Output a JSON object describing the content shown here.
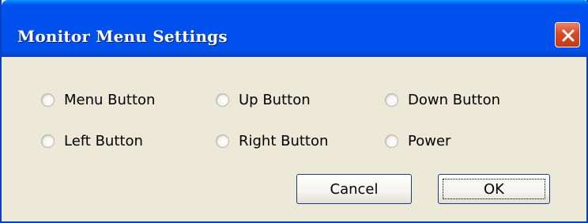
{
  "window": {
    "title": "Monitor Menu Settings",
    "close_icon": "close-icon"
  },
  "options": [
    {
      "label": "Menu Button",
      "checked": false
    },
    {
      "label": "Up Button",
      "checked": false
    },
    {
      "label": "Down Button",
      "checked": false
    },
    {
      "label": "Left Button",
      "checked": false
    },
    {
      "label": "Right Button",
      "checked": false
    },
    {
      "label": "Power",
      "checked": false
    }
  ],
  "buttons": {
    "cancel_label": "Cancel",
    "ok_label": "OK"
  },
  "colors": {
    "titlebar": "#0050ee",
    "client": "#ece9d8",
    "close": "#d94a24"
  }
}
